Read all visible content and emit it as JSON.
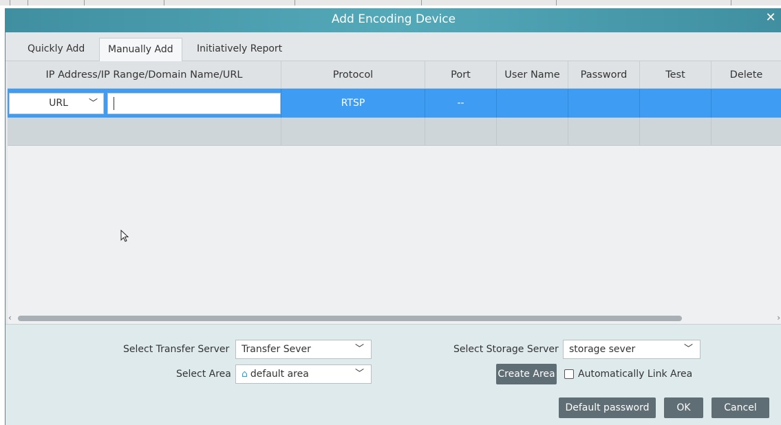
{
  "dialog": {
    "title": "Add Encoding Device",
    "close_icon": "close-icon"
  },
  "tabs": [
    {
      "label": "Quickly Add",
      "active": false
    },
    {
      "label": "Manually Add",
      "active": true
    },
    {
      "label": "Initiatively Report",
      "active": false
    }
  ],
  "table": {
    "columns": [
      "IP Address/IP Range/Domain Name/URL",
      "Protocol",
      "Port",
      "User Name",
      "Password",
      "Test",
      "Delete"
    ],
    "rows": [
      {
        "address_type": "URL",
        "address_value": "",
        "protocol": "RTSP",
        "port": "--",
        "user_name": "",
        "password": "",
        "test": "",
        "delete": ""
      }
    ]
  },
  "form": {
    "transfer_server_label": "Select Transfer Server",
    "transfer_server_value": "Transfer Sever",
    "storage_server_label": "Select Storage Server",
    "storage_server_value": "storage sever",
    "area_label": "Select Area",
    "area_value": "default area",
    "create_area_label": "Create Area",
    "auto_link_label": "Automatically Link Area",
    "auto_link_checked": false
  },
  "buttons": {
    "default_password": "Default password",
    "ok": "OK",
    "cancel": "Cancel"
  },
  "colors": {
    "titlebar": "#4aa3b4",
    "selected_row": "#3e9cf2",
    "button": "#5f6d75",
    "home_icon": "#2f9fd0"
  }
}
